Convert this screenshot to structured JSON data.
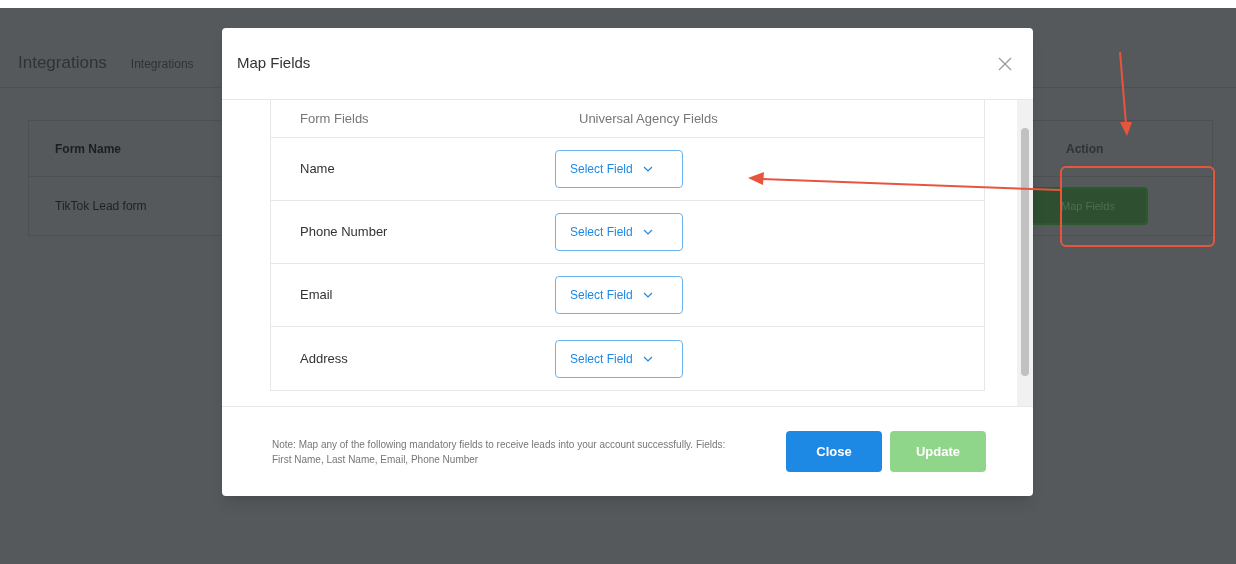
{
  "page": {
    "title": "Integrations",
    "tab": "Integrations",
    "table": {
      "columns": [
        "Form Name",
        "Action"
      ],
      "rows": [
        {
          "form_name": "TikTok Lead form",
          "action": "Map Fields"
        }
      ]
    }
  },
  "modal": {
    "title": "Map Fields",
    "columns": [
      "Form Fields",
      "Universal Agency Fields"
    ],
    "rows": [
      {
        "label": "Name",
        "select": "Select Field"
      },
      {
        "label": "Phone Number",
        "select": "Select Field"
      },
      {
        "label": "Email",
        "select": "Select Field"
      },
      {
        "label": "Address",
        "select": "Select Field"
      }
    ],
    "note": "Note: Map any of the following mandatory fields to receive leads into your account successfully. Fields: First Name, Last Name, Email, Phone Number",
    "buttons": [
      {
        "label": "Close",
        "kind": "primary",
        "disabled": false
      },
      {
        "label": "Update",
        "kind": "success",
        "disabled": true
      }
    ]
  }
}
